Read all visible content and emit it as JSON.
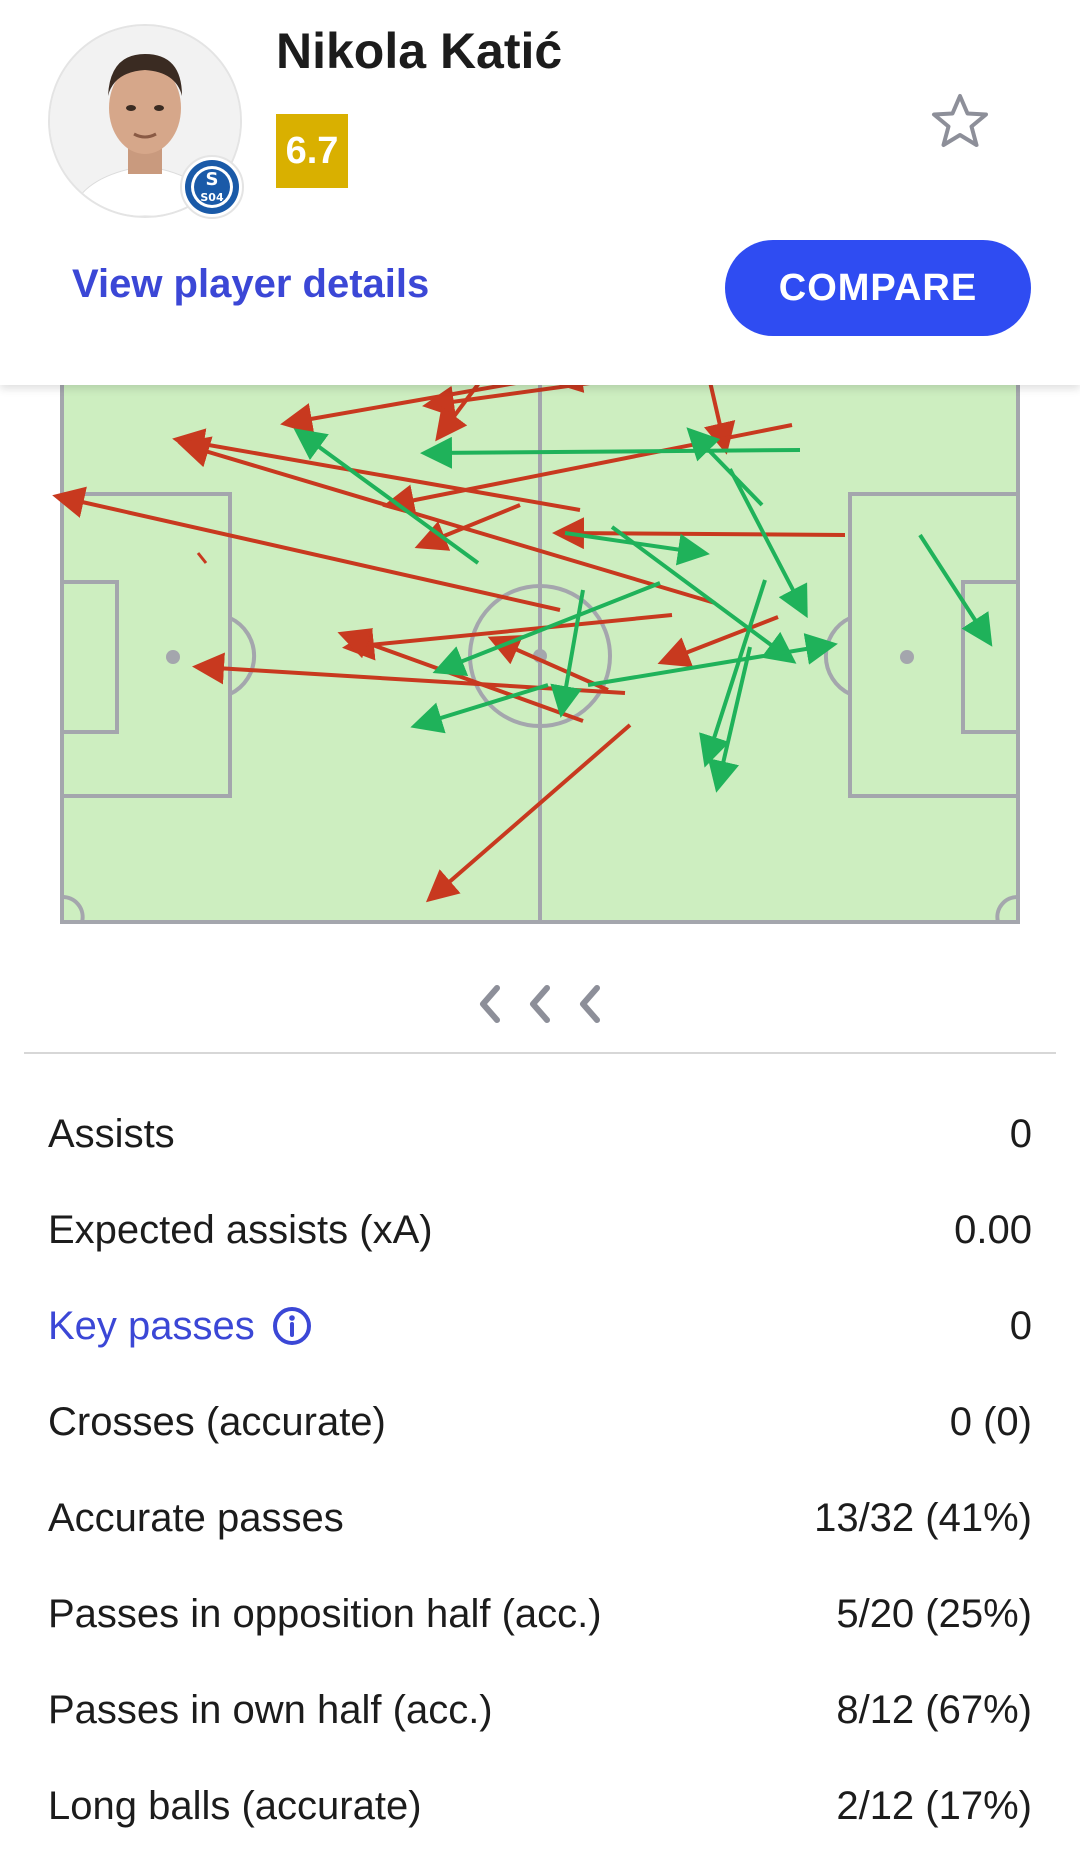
{
  "player": {
    "name": "Nikola Katić",
    "rating": "6.7",
    "rating_color": "#d9b000",
    "club_badge_text": "S04",
    "favorite_icon": "star-outline-icon"
  },
  "actions": {
    "details_label": "View player details",
    "compare_label": "COMPARE"
  },
  "pass_map": {
    "successful_color": "#1fb25a",
    "unsuccessful_color": "#c8391f",
    "pitch_color": "#cdeec0"
  },
  "stats": [
    {
      "label": "Assists",
      "value": "0"
    },
    {
      "label": "Expected assists (xA)",
      "value": "0.00"
    },
    {
      "label": "Key passes",
      "value": "0",
      "link": true,
      "icon": "info-icon"
    },
    {
      "label": "Crosses (accurate)",
      "value": "0 (0)"
    },
    {
      "label": "Accurate passes",
      "value": "13/32 (41%)"
    },
    {
      "label": "Passes in opposition half (acc.)",
      "value": "5/20 (25%)"
    },
    {
      "label": "Passes in own half (acc.)",
      "value": "8/12 (67%)"
    },
    {
      "label": "Long balls (accurate)",
      "value": "2/12 (17%)"
    }
  ]
}
